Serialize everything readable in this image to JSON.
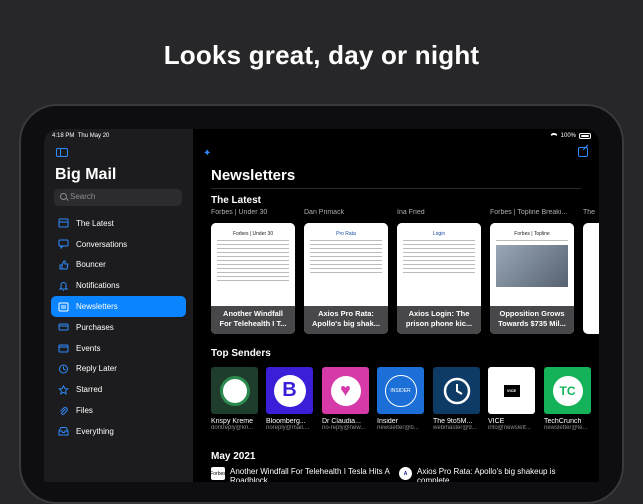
{
  "headline": "Looks great, day or night",
  "status_bar": {
    "time": "4:18 PM",
    "date": "Thu May 20",
    "battery": "100%"
  },
  "sidebar": {
    "title": "Big Mail",
    "search_placeholder": "Search",
    "items": [
      {
        "label": "The Latest",
        "icon": "latest-icon"
      },
      {
        "label": "Conversations",
        "icon": "conversations-icon"
      },
      {
        "label": "Bouncer",
        "icon": "thumbs-down-icon"
      },
      {
        "label": "Notifications",
        "icon": "bell-icon"
      },
      {
        "label": "Newsletters",
        "icon": "newsletter-icon",
        "active": true
      },
      {
        "label": "Purchases",
        "icon": "credit-card-icon"
      },
      {
        "label": "Events",
        "icon": "calendar-icon"
      },
      {
        "label": "Reply Later",
        "icon": "clock-icon"
      },
      {
        "label": "Starred",
        "icon": "star-icon"
      },
      {
        "label": "Files",
        "icon": "paperclip-icon"
      },
      {
        "label": "Everything",
        "icon": "tray-icon"
      }
    ]
  },
  "main": {
    "title": "Newsletters",
    "latest_heading": "The Latest",
    "latest": [
      {
        "sender": "Forbes | Under 30",
        "doc_header": "Forbes | Under 30",
        "caption": "Another Windfall For Telehealth I T..."
      },
      {
        "sender": "Dan Primack",
        "doc_header": "Pro Rata",
        "caption": "Axios Pro Rata: Apollo's big shak..."
      },
      {
        "sender": "Ina Fried",
        "doc_header": "Login",
        "caption": "Axios Login: The prison phone kic..."
      },
      {
        "sender": "Forbes | Topline Breaki...",
        "doc_header": "Forbes | Topline",
        "caption": "Opposition Grows Towards $735 Mil..."
      },
      {
        "sender": "The ",
        "doc_header": "",
        "caption": ""
      }
    ],
    "senders_heading": "Top Senders",
    "senders": [
      {
        "name": "Krispy Kreme",
        "email": "dontreply@kri...",
        "bg": "#1f3d2c",
        "logo": "krispy-kreme-logo"
      },
      {
        "name": "Bloomberg...",
        "email": "noreply@mail....",
        "bg": "#3a1fd8",
        "logo": "bloomberg-logo",
        "glyph": "B"
      },
      {
        "name": "Dr Claudia...",
        "email": "no-reply@new...",
        "bg": "#d63aa8",
        "logo": "heart-logo"
      },
      {
        "name": "Insider",
        "email": "newsletter@b...",
        "bg": "#1b6fd6",
        "logo": "insider-logo",
        "glyph": "INSIDER"
      },
      {
        "name": "The 9to5M...",
        "email": "webmaster@9...",
        "bg": "#0e3a66",
        "logo": "clock-logo"
      },
      {
        "name": "VICE",
        "email": "info@newslett...",
        "bg": "#ffffff",
        "logo": "vice-logo",
        "glyph": "VICE"
      },
      {
        "name": "TechCrunch",
        "email": "newsletter@te...",
        "bg": "#14b35a",
        "logo": "techcrunch-logo",
        "glyph": "TC"
      }
    ],
    "month_heading": "May 2021",
    "mails": [
      {
        "subject": "Another Windfall For Telehealth I Tesla Hits A Roadblock",
        "thumb": "Forbes"
      },
      {
        "subject": "Axios Pro Rata: Apollo's big shakeup is complete",
        "thumb": "A"
      }
    ]
  }
}
